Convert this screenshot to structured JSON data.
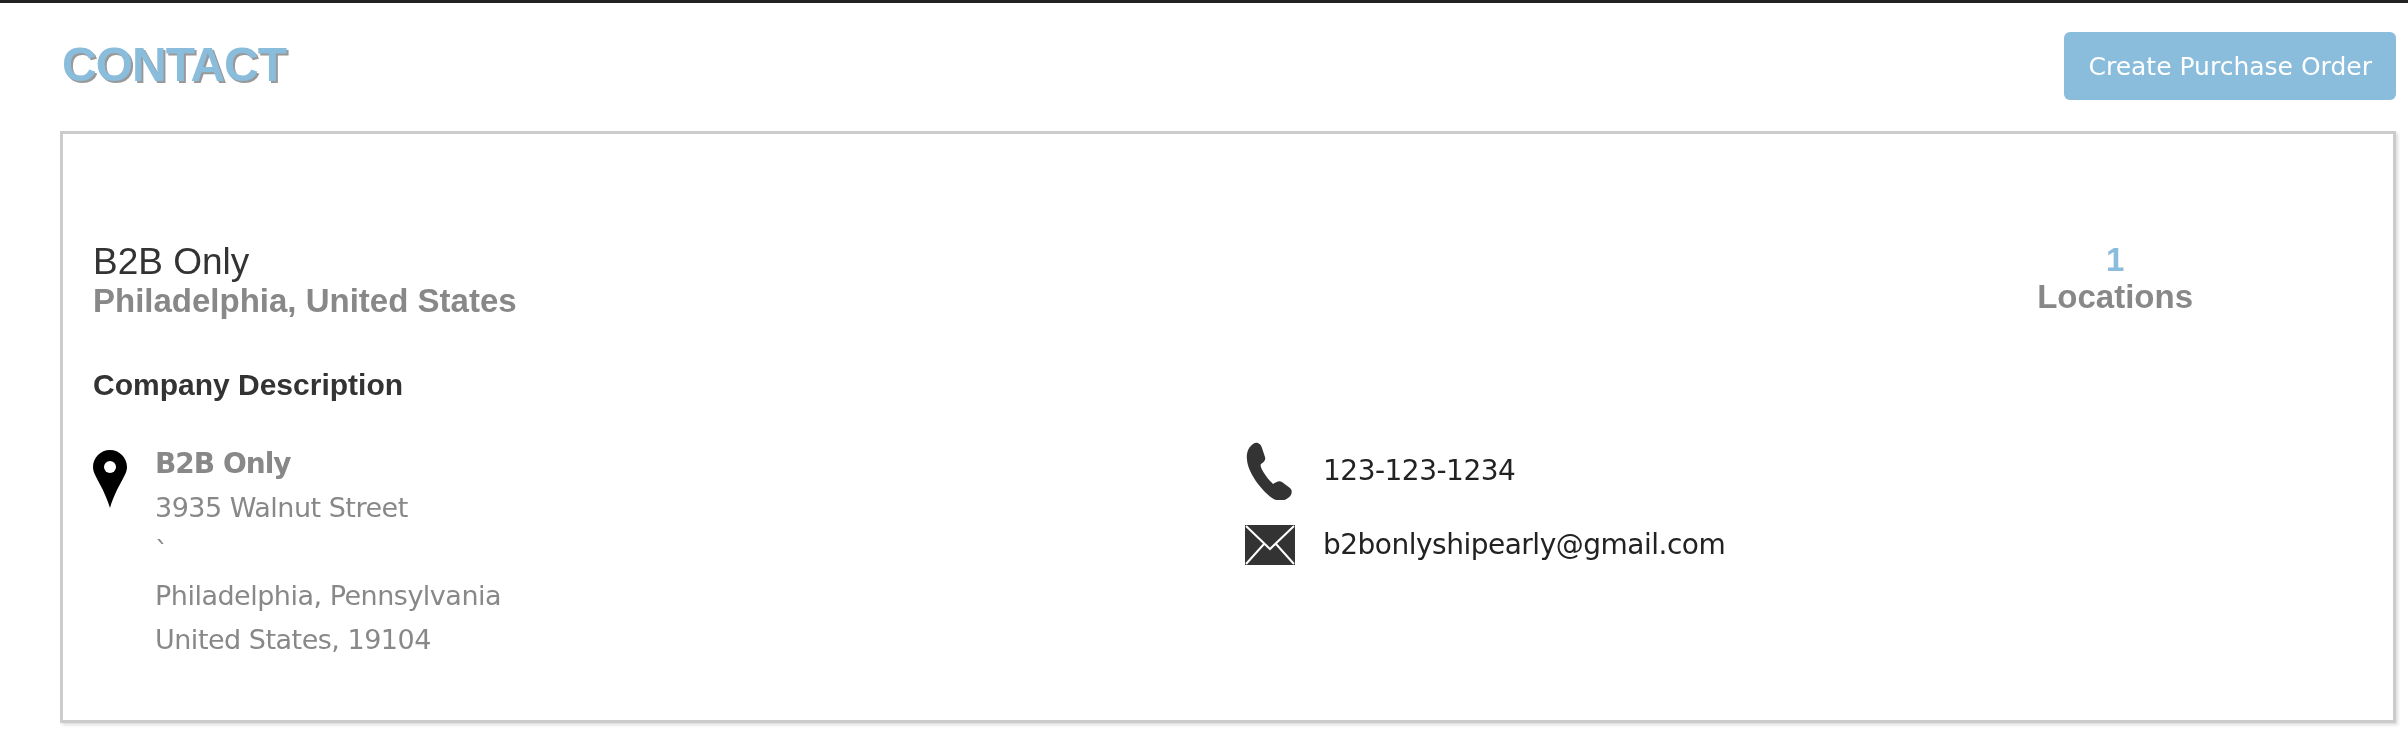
{
  "page_title": "CONTACT",
  "action_button": "Create Purchase Order",
  "company": {
    "name": "B2B Only",
    "location": "Philadelphia, United States",
    "locations_count": "1",
    "locations_label": "Locations",
    "description_heading": "Company Description"
  },
  "address": {
    "name": "B2B Only",
    "lines": [
      "3935 Walnut Street",
      "`",
      "Philadelphia, Pennsylvania",
      "United States, 19104"
    ]
  },
  "contacts": [
    {
      "kind": "phone",
      "value": "123-123-1234"
    },
    {
      "kind": "email",
      "value": "b2bonlyshipearly@gmail.com"
    }
  ]
}
